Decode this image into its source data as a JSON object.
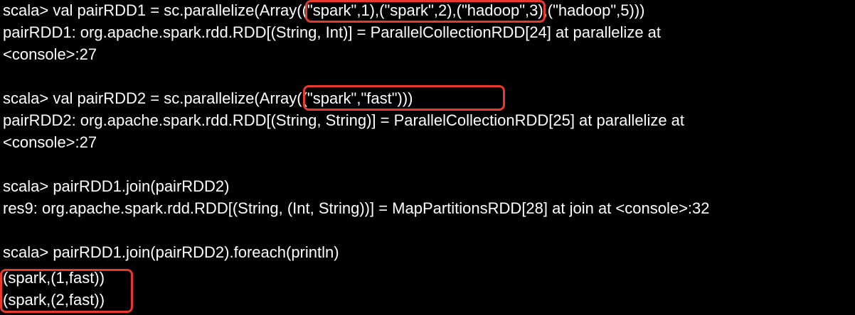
{
  "terminal": {
    "lines": [
      "scala> val pairRDD1 = sc.parallelize(Array((\"spark\",1),(\"spark\",2),(\"hadoop\",3),(\"hadoop\",5)))",
      "pairRDD1: org.apache.spark.rdd.RDD[(String, Int)] = ParallelCollectionRDD[24] at parallelize at",
      "<console>:27",
      "scala> val pairRDD2 = sc.parallelize(Array((\"spark\",\"fast\")))",
      "pairRDD2: org.apache.spark.rdd.RDD[(String, String)] = ParallelCollectionRDD[25] at parallelize at",
      "<console>:27",
      "scala> pairRDD1.join(pairRDD2)",
      "res9: org.apache.spark.rdd.RDD[(String, (Int, String))] = MapPartitionsRDD[28] at join at <console>:32",
      "scala> pairRDD1.join(pairRDD2).foreach(println)",
      "(spark,(1,fast))",
      "(spark,(2,fast))"
    ]
  },
  "colors": {
    "background": "#000000",
    "text": "#ffffff",
    "highlight_border": "#e8392c"
  }
}
